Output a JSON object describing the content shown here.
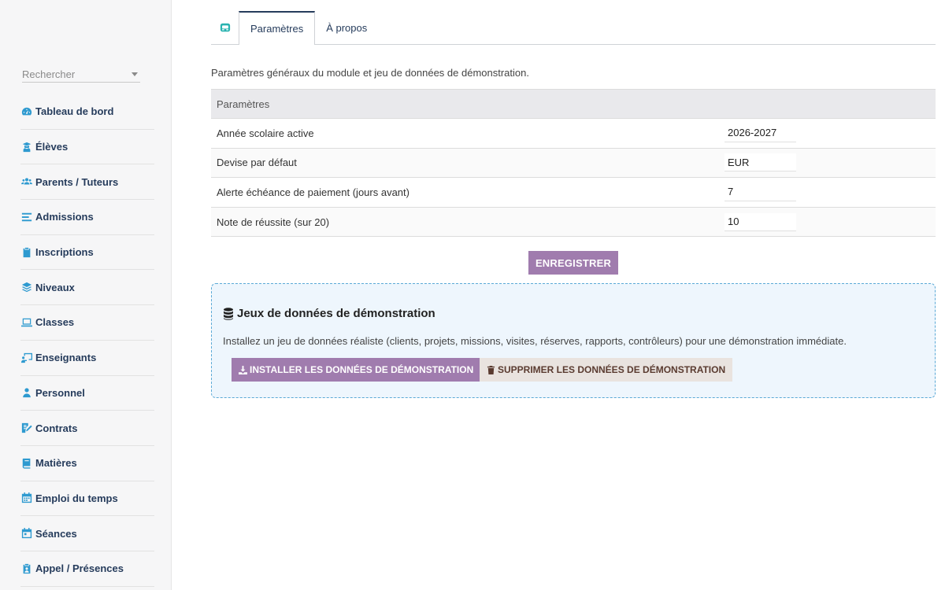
{
  "sidebar": {
    "search_placeholder": "Rechercher",
    "items": [
      {
        "label": "Tableau de bord",
        "icon": "dashboard-icon"
      },
      {
        "label": "Élèves",
        "icon": "student-icon"
      },
      {
        "label": "Parents / Tuteurs",
        "icon": "users-icon"
      },
      {
        "label": "Admissions",
        "icon": "list-icon"
      },
      {
        "label": "Inscriptions",
        "icon": "clipboard-check-icon"
      },
      {
        "label": "Niveaux",
        "icon": "layers-icon"
      },
      {
        "label": "Classes",
        "icon": "laptop-icon"
      },
      {
        "label": "Enseignants",
        "icon": "chalkboard-teacher-icon"
      },
      {
        "label": "Personnel",
        "icon": "person-icon"
      },
      {
        "label": "Contrats",
        "icon": "contract-icon"
      },
      {
        "label": "Matières",
        "icon": "book-icon"
      },
      {
        "label": "Emploi du temps",
        "icon": "calendar-icon"
      },
      {
        "label": "Séances",
        "icon": "calendar-day-icon"
      },
      {
        "label": "Appel / Présences",
        "icon": "clipboard-user-icon"
      }
    ]
  },
  "tabs": {
    "logo_icon": "module-logo-icon",
    "items": [
      {
        "label": "Paramètres",
        "active": true
      },
      {
        "label": "À propos",
        "active": false
      }
    ]
  },
  "main": {
    "description": "Paramètres généraux du module et jeu de données de démonstration.",
    "table_header": "Paramètres",
    "rows": [
      {
        "label": "Année scolaire active",
        "value": "2026-2027"
      },
      {
        "label": "Devise par défaut",
        "value": "EUR"
      },
      {
        "label": "Alerte échéance de paiement (jours avant)",
        "value": "7"
      },
      {
        "label": "Note de réussite (sur 20)",
        "value": "10"
      }
    ],
    "save_label": "ENREGISTRER"
  },
  "demo": {
    "title": "Jeux de données de démonstration",
    "text": "Installez un jeu de données réaliste (clients, projets, missions, visites, réserves, rapports, contrôleurs) pour une démonstration immédiate.",
    "install_label": "INSTALLER LES DONNÉES DE DÉMONSTRATION",
    "delete_label": "SUPPRIMER LES DONNÉES DE DÉMONSTRATION"
  },
  "colors": {
    "accent": "#a07cae",
    "sidebar_icon": "#2e9ad0",
    "nav_text": "#263c5c",
    "demo_bg": "#eef6fd",
    "demo_border": "#5aa9d6"
  }
}
